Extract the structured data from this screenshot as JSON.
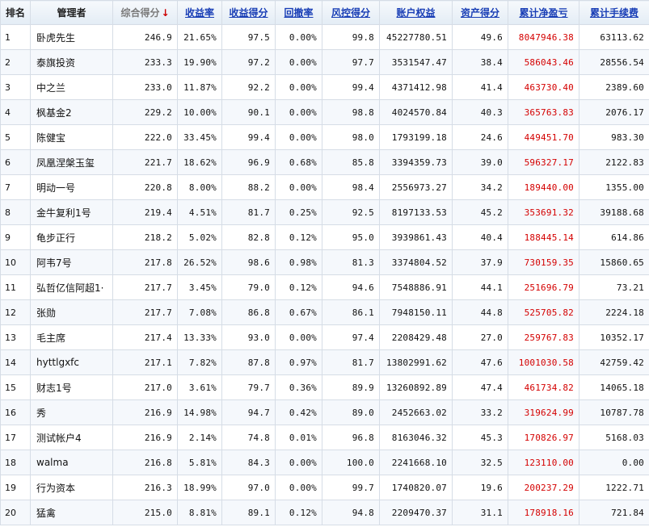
{
  "headers": {
    "rank": "排名",
    "manager": "管理者",
    "composite": "综合得分",
    "composite_arrow": "↓",
    "return_rate": "收益率",
    "return_score": "收益得分",
    "drawdown": "回撤率",
    "risk_score": "风控得分",
    "equity": "账户权益",
    "asset_score": "资产得分",
    "net_profit": "累计净盈亏",
    "fees": "累计手续费"
  },
  "rows": [
    {
      "rank": "1",
      "name": "卧虎先生",
      "composite": "246.9",
      "return_rate": "21.65%",
      "return_score": "97.5",
      "drawdown": "0.00%",
      "risk_score": "99.8",
      "equity": "45227780.51",
      "asset_score": "49.6",
      "net_profit": "8047946.38",
      "fees": "63113.62"
    },
    {
      "rank": "2",
      "name": "泰旗投资",
      "composite": "233.3",
      "return_rate": "19.90%",
      "return_score": "97.2",
      "drawdown": "0.00%",
      "risk_score": "97.7",
      "equity": "3531547.47",
      "asset_score": "38.4",
      "net_profit": "586043.46",
      "fees": "28556.54"
    },
    {
      "rank": "3",
      "name": "中之兰",
      "composite": "233.0",
      "return_rate": "11.87%",
      "return_score": "92.2",
      "drawdown": "0.00%",
      "risk_score": "99.4",
      "equity": "4371412.98",
      "asset_score": "41.4",
      "net_profit": "463730.40",
      "fees": "2389.60"
    },
    {
      "rank": "4",
      "name": "枫基金2",
      "composite": "229.2",
      "return_rate": "10.00%",
      "return_score": "90.1",
      "drawdown": "0.00%",
      "risk_score": "98.8",
      "equity": "4024570.84",
      "asset_score": "40.3",
      "net_profit": "365763.83",
      "fees": "2076.17"
    },
    {
      "rank": "5",
      "name": "陈健宝",
      "composite": "222.0",
      "return_rate": "33.45%",
      "return_score": "99.4",
      "drawdown": "0.00%",
      "risk_score": "98.0",
      "equity": "1793199.18",
      "asset_score": "24.6",
      "net_profit": "449451.70",
      "fees": "983.30"
    },
    {
      "rank": "6",
      "name": "凤凰涅槃玉玺",
      "composite": "221.7",
      "return_rate": "18.62%",
      "return_score": "96.9",
      "drawdown": "0.68%",
      "risk_score": "85.8",
      "equity": "3394359.73",
      "asset_score": "39.0",
      "net_profit": "596327.17",
      "fees": "2122.83"
    },
    {
      "rank": "7",
      "name": "明动一号",
      "composite": "220.8",
      "return_rate": "8.00%",
      "return_score": "88.2",
      "drawdown": "0.00%",
      "risk_score": "98.4",
      "equity": "2556973.27",
      "asset_score": "34.2",
      "net_profit": "189440.00",
      "fees": "1355.00"
    },
    {
      "rank": "8",
      "name": "金牛复利1号",
      "composite": "219.4",
      "return_rate": "4.51%",
      "return_score": "81.7",
      "drawdown": "0.25%",
      "risk_score": "92.5",
      "equity": "8197133.53",
      "asset_score": "45.2",
      "net_profit": "353691.32",
      "fees": "39188.68"
    },
    {
      "rank": "9",
      "name": "龟步正行",
      "composite": "218.2",
      "return_rate": "5.02%",
      "return_score": "82.8",
      "drawdown": "0.12%",
      "risk_score": "95.0",
      "equity": "3939861.43",
      "asset_score": "40.4",
      "net_profit": "188445.14",
      "fees": "614.86"
    },
    {
      "rank": "10",
      "name": "阿韦7号",
      "composite": "217.8",
      "return_rate": "26.52%",
      "return_score": "98.6",
      "drawdown": "0.98%",
      "risk_score": "81.3",
      "equity": "3374804.52",
      "asset_score": "37.9",
      "net_profit": "730159.35",
      "fees": "15860.65"
    },
    {
      "rank": "11",
      "name": "弘哲亿信阿超1·",
      "composite": "217.7",
      "return_rate": "3.45%",
      "return_score": "79.0",
      "drawdown": "0.12%",
      "risk_score": "94.6",
      "equity": "7548886.91",
      "asset_score": "44.1",
      "net_profit": "251696.79",
      "fees": "73.21"
    },
    {
      "rank": "12",
      "name": "张勋",
      "composite": "217.7",
      "return_rate": "7.08%",
      "return_score": "86.8",
      "drawdown": "0.67%",
      "risk_score": "86.1",
      "equity": "7948150.11",
      "asset_score": "44.8",
      "net_profit": "525705.82",
      "fees": "2224.18"
    },
    {
      "rank": "13",
      "name": "毛主席",
      "composite": "217.4",
      "return_rate": "13.33%",
      "return_score": "93.0",
      "drawdown": "0.00%",
      "risk_score": "97.4",
      "equity": "2208429.48",
      "asset_score": "27.0",
      "net_profit": "259767.83",
      "fees": "10352.17"
    },
    {
      "rank": "14",
      "name": "hyttlgxfc",
      "composite": "217.1",
      "return_rate": "7.82%",
      "return_score": "87.8",
      "drawdown": "0.97%",
      "risk_score": "81.7",
      "equity": "13802991.62",
      "asset_score": "47.6",
      "net_profit": "1001030.58",
      "fees": "42759.42"
    },
    {
      "rank": "15",
      "name": "财志1号",
      "composite": "217.0",
      "return_rate": "3.61%",
      "return_score": "79.7",
      "drawdown": "0.36%",
      "risk_score": "89.9",
      "equity": "13260892.89",
      "asset_score": "47.4",
      "net_profit": "461734.82",
      "fees": "14065.18"
    },
    {
      "rank": "16",
      "name": "秀",
      "composite": "216.9",
      "return_rate": "14.98%",
      "return_score": "94.7",
      "drawdown": "0.42%",
      "risk_score": "89.0",
      "equity": "2452663.02",
      "asset_score": "33.2",
      "net_profit": "319624.99",
      "fees": "10787.78"
    },
    {
      "rank": "17",
      "name": "测试帐户4",
      "composite": "216.9",
      "return_rate": "2.14%",
      "return_score": "74.8",
      "drawdown": "0.01%",
      "risk_score": "96.8",
      "equity": "8163046.32",
      "asset_score": "45.3",
      "net_profit": "170826.97",
      "fees": "5168.03"
    },
    {
      "rank": "18",
      "name": "walma",
      "composite": "216.8",
      "return_rate": "5.81%",
      "return_score": "84.3",
      "drawdown": "0.00%",
      "risk_score": "100.0",
      "equity": "2241668.10",
      "asset_score": "32.5",
      "net_profit": "123110.00",
      "fees": "0.00"
    },
    {
      "rank": "19",
      "name": "行为资本",
      "composite": "216.3",
      "return_rate": "18.99%",
      "return_score": "97.0",
      "drawdown": "0.00%",
      "risk_score": "99.7",
      "equity": "1740820.07",
      "asset_score": "19.6",
      "net_profit": "200237.29",
      "fees": "1222.71"
    },
    {
      "rank": "20",
      "name": "猛禽",
      "composite": "215.0",
      "return_rate": "8.81%",
      "return_score": "89.1",
      "drawdown": "0.12%",
      "risk_score": "94.8",
      "equity": "2209470.37",
      "asset_score": "31.1",
      "net_profit": "178918.16",
      "fees": "721.84"
    }
  ]
}
